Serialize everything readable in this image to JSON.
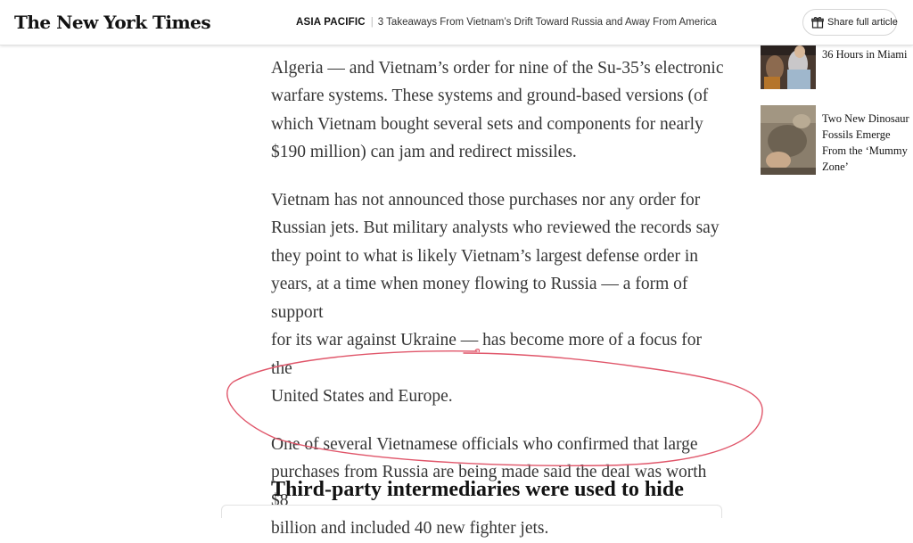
{
  "header": {
    "logo": "The New York Times",
    "section": "ASIA PACIFIC",
    "article_title": "3 Takeaways From Vietnam’s Drift Toward Russia and Away From America",
    "share_label": "Share full article"
  },
  "article": {
    "para1": [
      "Algeria — and Vietnam’s order for nine of the Su-35’s electronic",
      "warfare systems. These systems and ground-based versions (of",
      "which Vietnam bought several sets and components for nearly",
      "$190 million) can jam and redirect missiles."
    ],
    "para2": [
      "Vietnam has not announced those purchases nor any order for",
      "Russian jets. But military analysts who reviewed the records say",
      "they point to what is likely Vietnam’s largest defense order in",
      "years, at a time when money flowing to Russia — a form of support",
      "for its war against Ukraine — has become more of a focus for the",
      "United States and Europe."
    ],
    "para3": [
      "One of several Vietnamese officials who confirmed that large",
      "purchases from Russia are being made said the deal was worth $8",
      "billion and included 40 new fighter jets."
    ],
    "subhead": "Third-party intermediaries were used to hide"
  },
  "sidebar": {
    "items": [
      {
        "title": "36 Hours in Miami"
      },
      {
        "title": "Two New Dinosaur Fossils Emerge From the ‘Mummy Zone’"
      }
    ]
  },
  "colors": {
    "annotation": "#e0566a",
    "text": "#363636",
    "headline": "#121212"
  }
}
